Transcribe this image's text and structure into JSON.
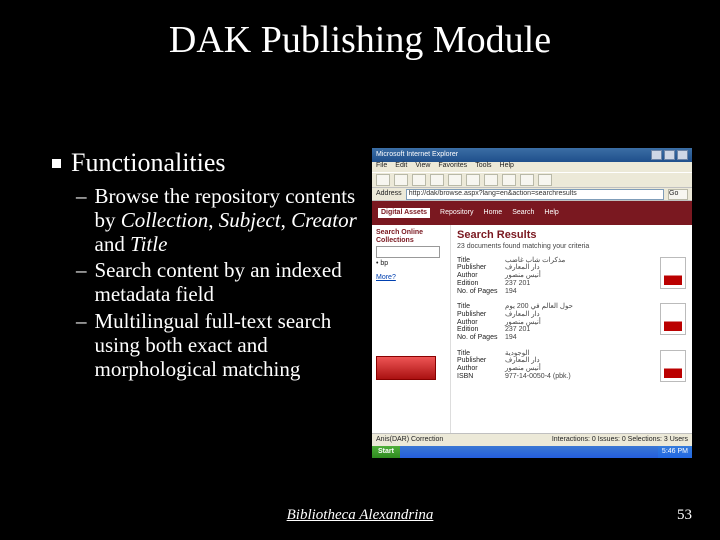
{
  "title": "DAK Publishing Module",
  "section": "Functionalities",
  "bullets": [
    {
      "prefix": "Browse the repository contents by ",
      "i1": "Collection",
      "s1": ", ",
      "i2": "Subject",
      "s2": ", ",
      "i3": "Creator",
      "s3": " and ",
      "i4": "Title"
    },
    {
      "text": "Search content by an indexed metadata field"
    },
    {
      "text": "Multilingual full-text search using both exact and morphological matching"
    }
  ],
  "footer": {
    "caption": "Bibliotheca Alexandrina",
    "page": "53"
  },
  "shot": {
    "window_title": "Microsoft Internet Explorer",
    "menu": [
      "File",
      "Edit",
      "View",
      "Favorites",
      "Tools",
      "Help"
    ],
    "address_label": "Address",
    "address_url": "http://dak/browse.aspx?lang=en&action=searchresults",
    "go": "Go",
    "brand1": "Digital",
    "brand2": "Assets",
    "brand3": "Repository",
    "nav": [
      "Home",
      "Search",
      "Help"
    ],
    "left": {
      "heading": "Search Online Collections",
      "bullet": "• bp",
      "link": "More?"
    },
    "main": {
      "heading": "Search Results",
      "subtitle": "23 documents found matching your criteria",
      "labels": {
        "title": "Title",
        "publisher": "Publisher",
        "author": "Author",
        "edition": "Edition",
        "pages": "No. of Pages",
        "isbn": "ISBN"
      },
      "results": [
        {
          "title": "مذكرات شاب غاضب",
          "publisher": "دار المعارف",
          "author": "أنيس منصور",
          "edition": "237 201",
          "pages": "194"
        },
        {
          "title": "حول العالم في 200 يوم",
          "publisher": "دار المعارف",
          "author": "أنيس منصور",
          "edition": "237 201",
          "pages": "194"
        },
        {
          "title": "الوجودية",
          "publisher": "دار المعارف",
          "author": "أنيس منصور",
          "isbn": "977-14-0050-4 (pbk.)"
        }
      ]
    },
    "status_left": "Anis(DAR) Correction",
    "status_right": "Interactions: 0  Issues: 0  Selections: 3  Users",
    "start": "Start",
    "clock": "5:46 PM"
  }
}
